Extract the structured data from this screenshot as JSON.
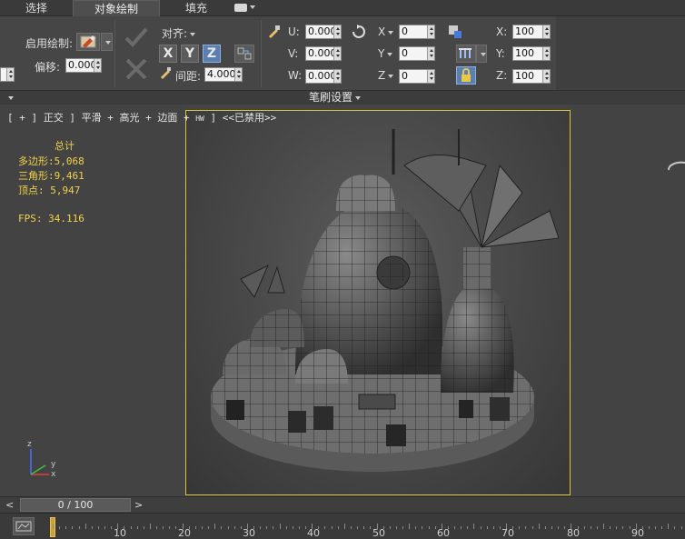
{
  "tabs": [
    {
      "label": "选择"
    },
    {
      "label": "对象绘制"
    },
    {
      "label": "填充"
    }
  ],
  "paint": {
    "enable_label": "启用绘制:",
    "offset_label": "偏移:",
    "offset_value": "0.000"
  },
  "align": {
    "label": "对齐:",
    "x": "X",
    "y": "Y",
    "z": "Z",
    "spacing_label": "间距:",
    "spacing_value": "4.000"
  },
  "uvw": {
    "u_label": "U:",
    "u_value": "0.000",
    "v_label": "V:",
    "v_value": "0.000",
    "w_label": "W:",
    "w_value": "0.000"
  },
  "rotate": {
    "x_label": "X",
    "x_value": "0",
    "y_label": "Y",
    "y_value": "0",
    "z_label": "Z",
    "z_value": "0"
  },
  "scale": {
    "x_label": "X:",
    "x_value": "100",
    "y_label": "Y:",
    "y_value": "100",
    "z_label": "Z:",
    "z_value": "100"
  },
  "brush_settings_label": "笔刷设置",
  "viewport": {
    "label_prefix": "[ + ] 正交 ] 平滑 + 高光 + 边面 +",
    "hw_label": "HW",
    "label_suffix": "] <<已禁用>>"
  },
  "stats": {
    "title": "总计",
    "polys": "多边形:5,068",
    "tris": "三角形:9,461",
    "verts": "顶点: 5,947",
    "fps": "FPS:  34.116"
  },
  "axis": {
    "x": "x",
    "y": "y",
    "z": "z"
  },
  "timeline": {
    "frame_display": "0 / 100",
    "prev": "<",
    "next": ">",
    "ticks": [
      "10",
      "20",
      "30",
      "40",
      "50",
      "60",
      "70",
      "80",
      "90"
    ]
  },
  "colors": {
    "viewport_border": "#d7c43b",
    "stats_text": "#f2d24a",
    "axis_x": "#e23c3c",
    "axis_y": "#3cc23c",
    "axis_z": "#4a6cff",
    "active_axis": "#5b7fb0"
  }
}
